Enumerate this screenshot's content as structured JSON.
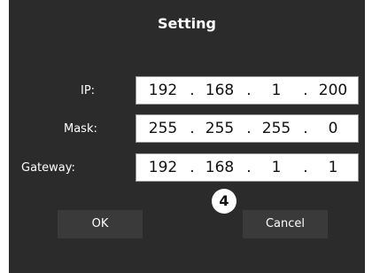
{
  "dialog": {
    "title": "Setting",
    "ok_label": "OK",
    "cancel_label": "Cancel",
    "step_badge": "4"
  },
  "fields": {
    "ip": {
      "label": "IP:",
      "octets": [
        "192",
        "168",
        "1",
        "200"
      ]
    },
    "mask": {
      "label": "Mask:",
      "octets": [
        "255",
        "255",
        "255",
        "0"
      ]
    },
    "gateway": {
      "label": "Gateway:",
      "octets": [
        "192",
        "168",
        "1",
        "1"
      ]
    }
  },
  "separator": ".",
  "colors": {
    "dialog_background": "#2b2b2b",
    "button_background": "#3a3a3a",
    "text": "#ffffff"
  }
}
